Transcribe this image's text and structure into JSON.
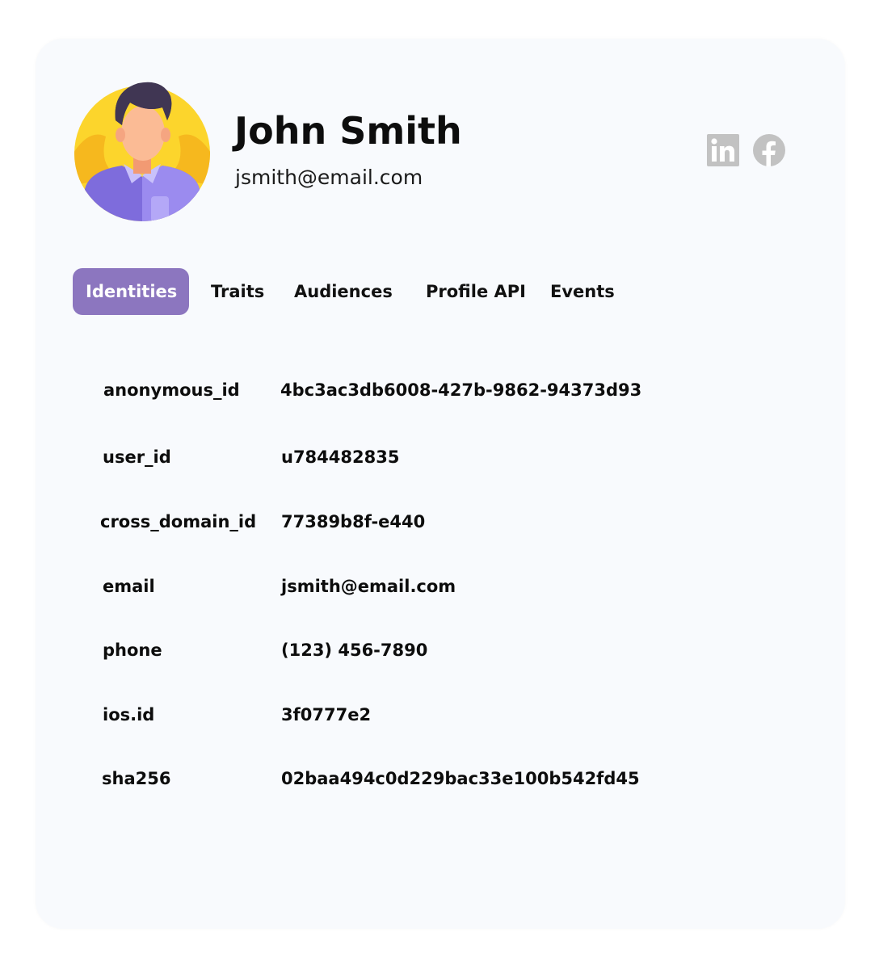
{
  "profile": {
    "name": "John Smith",
    "email": "jsmith@email.com"
  },
  "social": {
    "linkedin_icon": "linkedin-icon",
    "facebook_icon": "facebook-icon",
    "icon_color": "#c2c2c2"
  },
  "tabs": [
    {
      "label": "Identities",
      "active": true
    },
    {
      "label": "Traits",
      "active": false
    },
    {
      "label": "Audiences",
      "active": false
    },
    {
      "label": "Profile API",
      "active": false
    },
    {
      "label": "Events",
      "active": false
    }
  ],
  "identities": [
    {
      "key": "anonymous_id",
      "value": "4bc3ac3db6008-427b-9862-94373d93"
    },
    {
      "key": "user_id",
      "value": "u784482835"
    },
    {
      "key": "cross_domain_id",
      "value": "77389b8f-e440"
    },
    {
      "key": "email",
      "value": "jsmith@email.com"
    },
    {
      "key": "phone",
      "value": "(123) 456-7890"
    },
    {
      "key": "ios.id",
      "value": "3f0777e2"
    },
    {
      "key": "sha256",
      "value": "02baa494c0d229bac33e100b542fd45"
    }
  ],
  "colors": {
    "accent": "#8c76bf",
    "card_background": "#f8fafd",
    "avatar_background": "#fcd52c"
  }
}
